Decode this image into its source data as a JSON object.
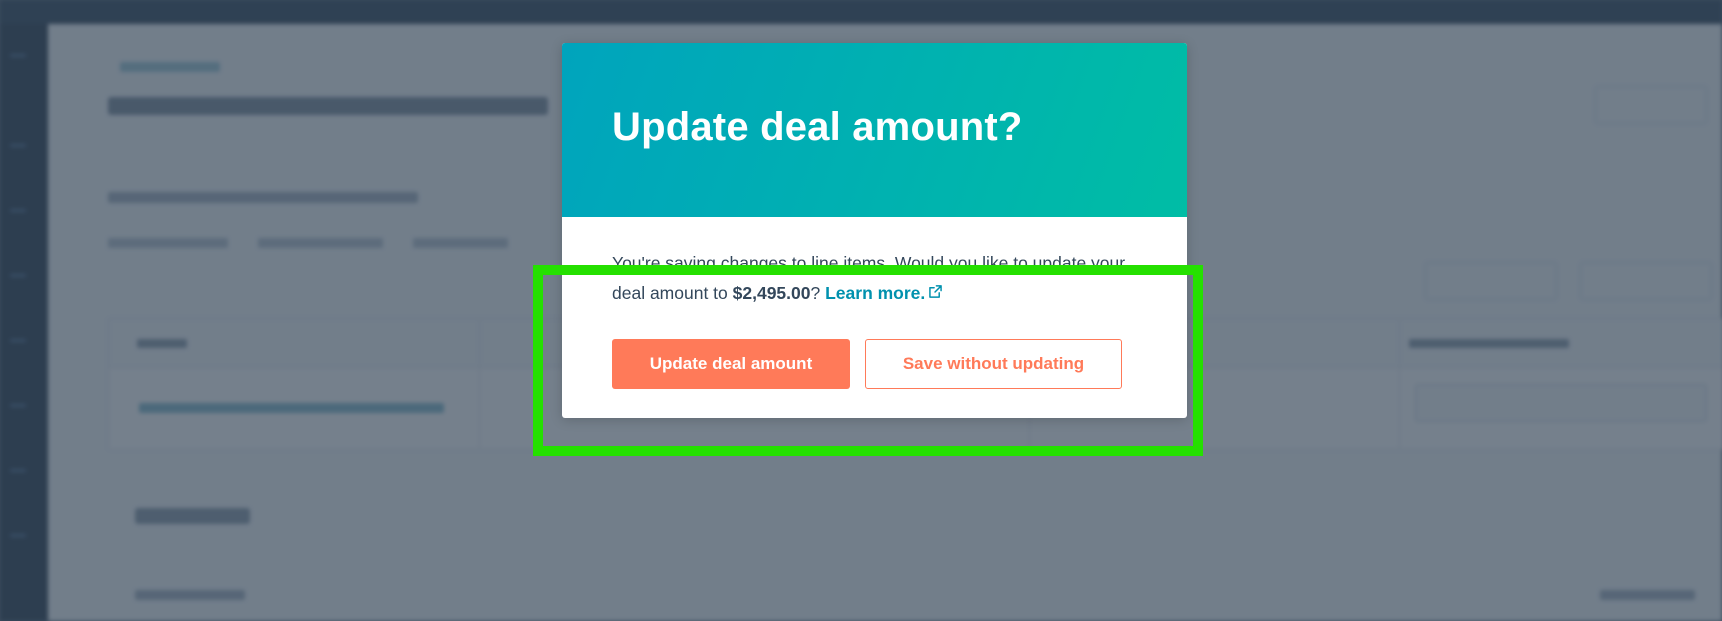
{
  "modal": {
    "title": "Update deal amount?",
    "body_prefix": "You're saving changes to line items. Would you like to update your deal amount to ",
    "amount": "$2,495.00",
    "body_suffix": "? ",
    "learn_more": "Learn more.",
    "external_link_icon": "external-link-icon",
    "primary_button": "Update deal amount",
    "secondary_button": "Save without updating"
  },
  "colors": {
    "header_gradient_start": "#00a4bd",
    "header_gradient_end": "#00bda5",
    "primary_button": "#ff7a59",
    "link": "#0091ae",
    "body_text": "#33475b",
    "highlight": "#25e000",
    "overlay": "#2d3e50"
  }
}
